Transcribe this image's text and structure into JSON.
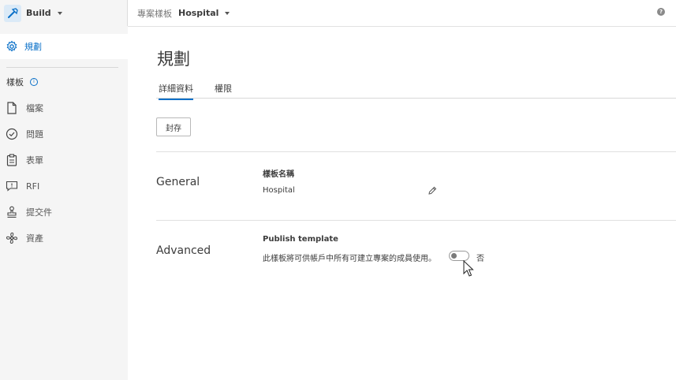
{
  "app": {
    "name": "Build"
  },
  "breadcrumb": {
    "label": "專案樣板",
    "value": "Hospital"
  },
  "sidebar": {
    "active_item": "規劃",
    "section_title": "樣板",
    "items": [
      {
        "label": "檔案",
        "icon": "file-icon"
      },
      {
        "label": "問題",
        "icon": "check-circle-icon"
      },
      {
        "label": "表單",
        "icon": "clipboard-icon"
      },
      {
        "label": "RFI",
        "icon": "rfi-icon"
      },
      {
        "label": "提交件",
        "icon": "stamp-icon"
      },
      {
        "label": "資產",
        "icon": "fan-icon"
      }
    ]
  },
  "page": {
    "title": "規劃",
    "tabs": [
      {
        "label": "詳細資料",
        "active": true
      },
      {
        "label": "權限",
        "active": false
      }
    ],
    "archive_label": "封存"
  },
  "general": {
    "title": "General",
    "field_label": "樣板名稱",
    "field_value": "Hospital"
  },
  "advanced": {
    "title": "Advanced",
    "field_label": "Publish template",
    "description": "此樣板將可供帳戶中所有可建立專案的成員使用。",
    "toggle_state": "否"
  },
  "colors": {
    "accent": "#0a70c8",
    "sidebar_bg": "#f5f5f5"
  }
}
